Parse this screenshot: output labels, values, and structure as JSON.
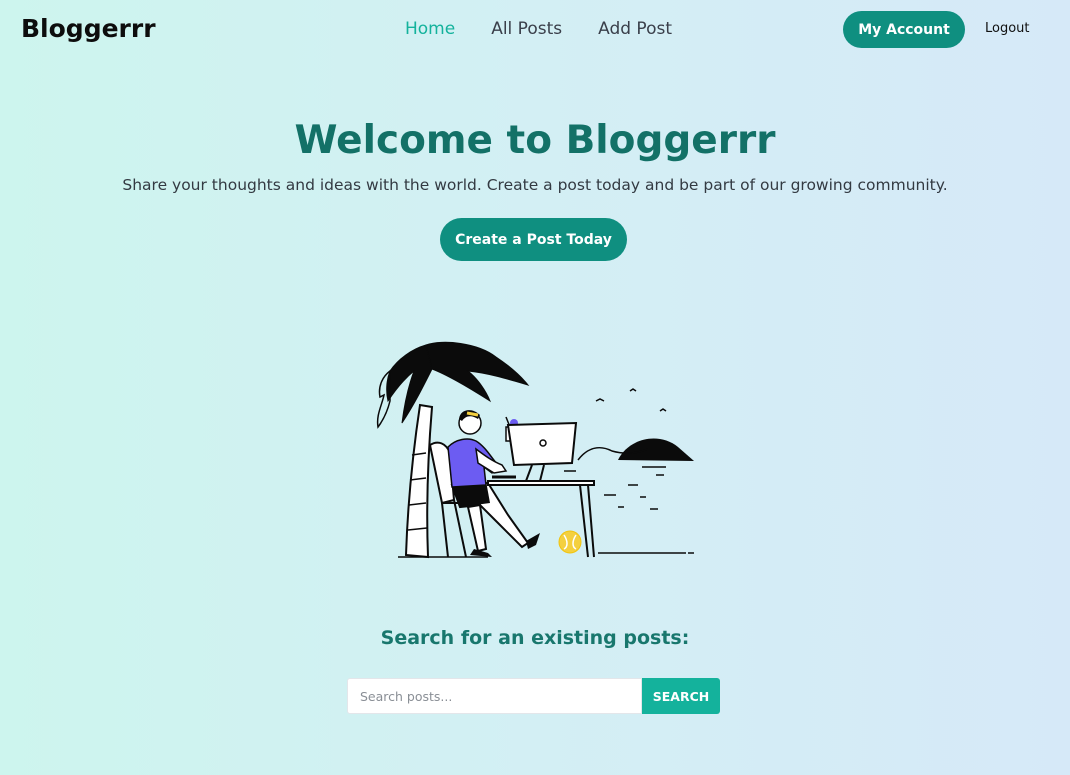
{
  "brand": "Bloggerrr",
  "nav": {
    "links": [
      {
        "label": "Home",
        "active": true
      },
      {
        "label": "All Posts",
        "active": false
      },
      {
        "label": "Add Post",
        "active": false
      }
    ],
    "account_label": "My Account",
    "logout_label": "Logout"
  },
  "hero": {
    "title": "Welcome to Bloggerrr",
    "subtitle": "Share your thoughts and ideas with the world. Create a post today and be part of our growing community.",
    "cta_label": "Create a Post Today"
  },
  "search": {
    "heading": "Search for an existing posts:",
    "placeholder": "Search posts...",
    "value": "",
    "button_label": "SEARCH"
  },
  "colors": {
    "accent": "#14b29c",
    "primary_button": "#0f8f80",
    "title": "#137167"
  },
  "illustration": "person-working-on-laptop-under-palm-tree-icon"
}
